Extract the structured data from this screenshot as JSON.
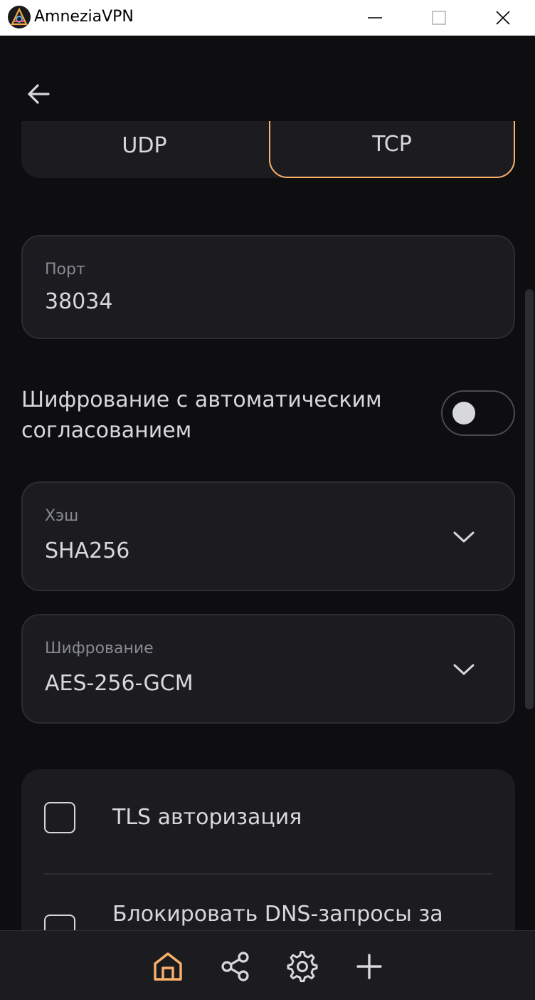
{
  "window": {
    "title": "AmneziaVPN"
  },
  "protocol": {
    "options": [
      "UDP",
      "TCP"
    ],
    "selected": "TCP"
  },
  "port": {
    "label": "Порт",
    "value": "38034"
  },
  "ncp": {
    "label": "Шифрование с автоматическим согласованием",
    "enabled": false
  },
  "hash": {
    "label": "Хэш",
    "value": "SHA256"
  },
  "cipher": {
    "label": "Шифрование",
    "value": "AES-256-GCM"
  },
  "options": {
    "tls_auth": {
      "label": "TLS авторизация",
      "checked": false
    },
    "block_dns": {
      "label": "Блокировать DNS-запросы за",
      "checked": false
    }
  },
  "nav": {
    "items": [
      "home-icon",
      "share-icon",
      "settings-icon",
      "add-icon"
    ],
    "active": "home-icon"
  },
  "colors": {
    "accent": "#fbb26a",
    "background": "#0e0e11",
    "surface": "#1c1c20",
    "text": "#d7d8db",
    "muted": "#878b91"
  }
}
